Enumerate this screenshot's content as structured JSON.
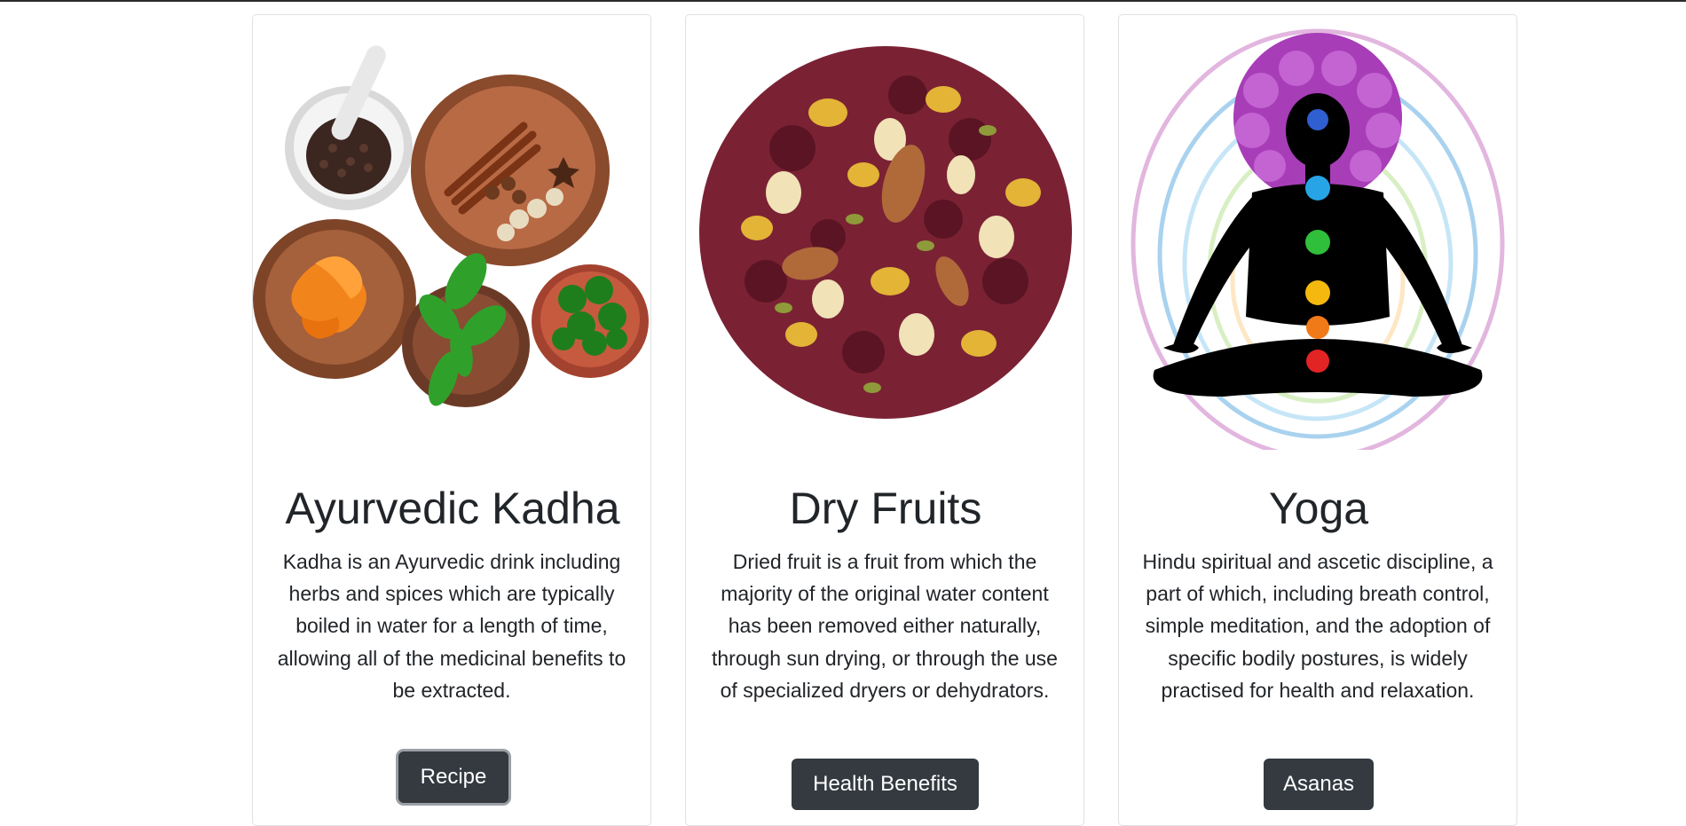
{
  "cards": [
    {
      "title": "Ayurvedic Kadha",
      "text": "Kadha is an Ayurvedic drink including herbs and spices which are typically boiled in water for a length of time, allowing all of the medicinal benefits to be extracted.",
      "button_label": "Recipe",
      "button_focused": true,
      "image": "kadha-spices-image"
    },
    {
      "title": "Dry Fruits",
      "text": "Dried fruit is a fruit from which the majority of the original water content has been removed either naturally, through sun drying, or through the use of specialized dryers or dehydrators.",
      "button_label": "Health Benefits",
      "button_focused": false,
      "image": "dry-fruits-image"
    },
    {
      "title": "Yoga",
      "text": "Hindu spiritual and ascetic discipline, a part of which, including breath control, simple meditation, and the adoption of specific bodily postures, is widely practised for health and relaxation.",
      "button_label": "Asanas",
      "button_focused": false,
      "image": "yoga-meditation-image"
    }
  ],
  "colors": {
    "button_bg": "#343a40",
    "button_text": "#ffffff",
    "card_border": "#dfe1e4",
    "text": "#212529"
  }
}
